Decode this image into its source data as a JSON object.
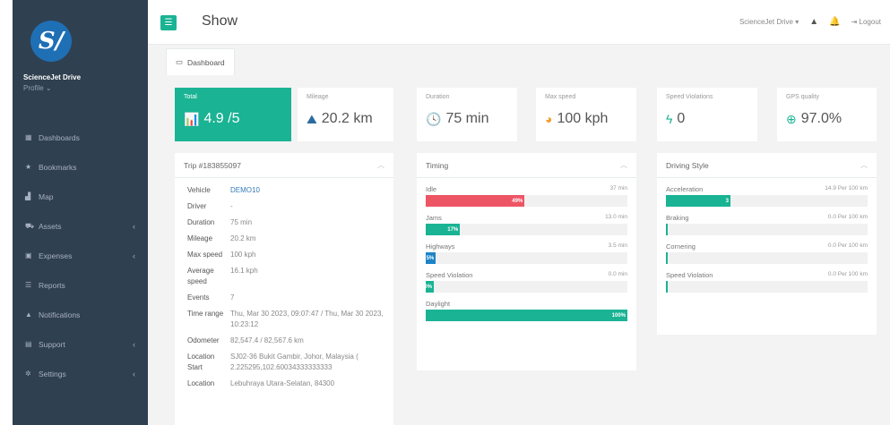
{
  "sidebar": {
    "logo_text": "S/",
    "brand": "ScienceJet Drive",
    "profile": "Profile ⌄",
    "items": [
      {
        "label": "Dashboards",
        "icon": "dashboard-icon",
        "glyph": "▦",
        "caret": ""
      },
      {
        "label": "Bookmarks",
        "icon": "star-icon",
        "glyph": "★",
        "caret": ""
      },
      {
        "label": "Map",
        "icon": "chart-icon",
        "glyph": "▟",
        "caret": ""
      },
      {
        "label": "Assets",
        "icon": "car-icon",
        "glyph": "⛟",
        "caret": "‹"
      },
      {
        "label": "Expenses",
        "icon": "money-icon",
        "glyph": "▣",
        "caret": "‹"
      },
      {
        "label": "Reports",
        "icon": "list-icon",
        "glyph": "☰",
        "caret": ""
      },
      {
        "label": "Notifications",
        "icon": "warning-icon",
        "glyph": "▲",
        "caret": ""
      },
      {
        "label": "Support",
        "icon": "support-icon",
        "glyph": "▤",
        "caret": "‹"
      },
      {
        "label": "Settings",
        "icon": "gear-icon",
        "glyph": "✲",
        "caret": "‹"
      }
    ]
  },
  "topbar": {
    "title": "Show",
    "menu_glyph": "☰",
    "account": "ScienceJet Drive ▾",
    "warning_glyph": "▲",
    "bell_glyph": "🔔",
    "logout_glyph": "⇥",
    "logout": "Logout"
  },
  "tab": {
    "label": "Dashboard",
    "glyph": "▭"
  },
  "stats": [
    {
      "label": "Total",
      "value": "4.9 /5",
      "glyph": "📊",
      "icon": "bar-chart-icon",
      "color": "#ffffff"
    },
    {
      "label": "Mileage",
      "value": "20.2 km",
      "glyph": "⛰",
      "icon": "road-icon",
      "color": "#2c6aa0"
    },
    {
      "label": "Duration",
      "value": "75 min",
      "glyph": "🕓",
      "icon": "clock-icon",
      "color": "#2c6aa0"
    },
    {
      "label": "Max speed",
      "value": "100 kph",
      "glyph": "◕",
      "icon": "speedometer-icon",
      "color": "#f0a030"
    },
    {
      "label": "Speed Violations",
      "value": "0",
      "glyph": "ϟ",
      "icon": "bolt-icon",
      "color": "#1ab394"
    },
    {
      "label": "GPS quality",
      "value": "97.0%",
      "glyph": "⊕",
      "icon": "globe-icon",
      "color": "#1ab394"
    }
  ],
  "trip": {
    "title": "Trip #183855097",
    "rows": [
      {
        "k": "Vehicle",
        "v": "DEMO10"
      },
      {
        "k": "Driver",
        "v": "-"
      },
      {
        "k": "Duration",
        "v": "75 min"
      },
      {
        "k": "Mileage",
        "v": "20.2 km"
      },
      {
        "k": "Max speed",
        "v": "100 kph"
      },
      {
        "k": "Average speed",
        "v": "16.1 kph"
      },
      {
        "k": "Events",
        "v": "7"
      },
      {
        "k": "Time range",
        "v": "Thu, Mar 30 2023, 09:07:47 / Thu, Mar 30 2023, 10:23:12"
      },
      {
        "k": "Odometer",
        "v": "82,547.4 / 82,567.6 km"
      },
      {
        "k": "Location Start",
        "v": "SJ02-36 Bukit Gambir, Johor, Malaysia ( 2.225295,102.60034333333333"
      },
      {
        "k": "Location",
        "v": "Lebuhraya Utara-Selatan, 84300"
      }
    ]
  },
  "timing": {
    "title": "Timing",
    "bars": [
      {
        "label": "Idle",
        "right": "37 min",
        "pct": 49,
        "text": "49%",
        "color": "#ed5565"
      },
      {
        "label": "Jams",
        "right": "13.0 min",
        "pct": 17,
        "text": "17%",
        "color": "#1ab394"
      },
      {
        "label": "Highways",
        "right": "3.5 min",
        "pct": 5,
        "text": "5%",
        "color": "#1c84c6"
      },
      {
        "label": "Speed Violation",
        "right": "0.0 min",
        "pct": 0,
        "text": "0%",
        "color": "#1ab394"
      },
      {
        "label": "Daylight",
        "right": "",
        "pct": 100,
        "text": "100%",
        "color": "#1ab394"
      }
    ]
  },
  "driving": {
    "title": "Driving Style",
    "bars": [
      {
        "label": "Acceleration",
        "right": "14.9 Per 100 km",
        "pct": 32,
        "text": "3",
        "color": "#1ab394"
      },
      {
        "label": "Braking",
        "right": "0.0 Per 100 km",
        "pct": 0,
        "text": "",
        "color": "#1ab394"
      },
      {
        "label": "Cornering",
        "right": "0.0 Per 100 km",
        "pct": 0,
        "text": "",
        "color": "#1ab394"
      },
      {
        "label": "Speed Violation",
        "right": "0.0 Per 100 km",
        "pct": 0,
        "text": "",
        "color": "#1ab394"
      }
    ]
  }
}
